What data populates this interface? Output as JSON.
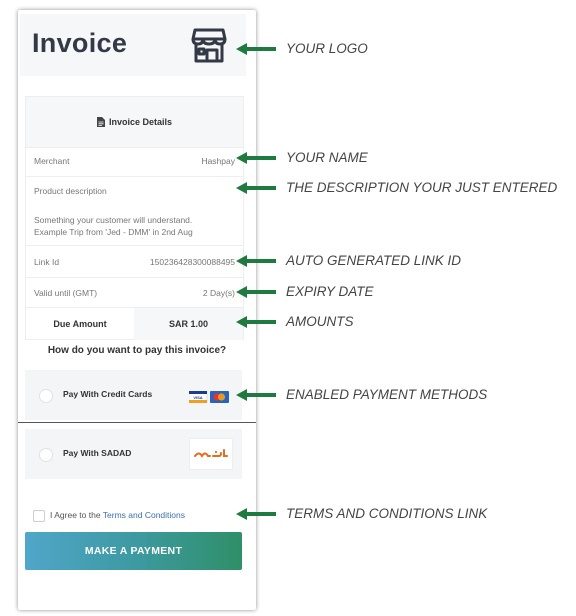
{
  "invoice": {
    "title": "Invoice",
    "details_heading": "Invoice Details",
    "merchant_label": "Merchant",
    "merchant_value": "Hashpay",
    "product_description_label": "Product description",
    "product_description_line1": "Something your customer will understand.",
    "product_description_line2": "Example Trip from 'Jed - DMM' in 2nd Aug",
    "link_id_label": "Link Id",
    "link_id_value": "150236428300088495",
    "valid_until_label": "Valid until (GMT)",
    "valid_until_value": "2 Day(s)",
    "due_amount_label": "Due Amount",
    "due_amount_value": "SAR 1.00",
    "pay_question": "How do you want to pay this invoice?",
    "payment_methods": [
      {
        "label": "Pay With Credit Cards",
        "icon": "visa-mastercard-icon"
      },
      {
        "label": "Pay With SADAD",
        "icon": "sadad-logo-icon"
      }
    ],
    "terms_prefix": "I Agree to the",
    "terms_link": "Terms and Conditions",
    "submit_label": "MAKE A PAYMENT"
  },
  "annotations": [
    "YOUR LOGO",
    "YOUR NAME",
    "THE DESCRIPTION YOUR JUST ENTERED",
    "AUTO GENERATED LINK ID",
    "EXPIRY DATE",
    "AMOUNTS",
    "ENABLED PAYMENT METHODS",
    "TERMS AND CONDITIONS LINK"
  ],
  "colors": {
    "arrow": "#1f7a3f",
    "button_start": "#4fa6c9",
    "button_end": "#2f8f68",
    "title": "#333a45",
    "link": "#3a6fb0"
  }
}
